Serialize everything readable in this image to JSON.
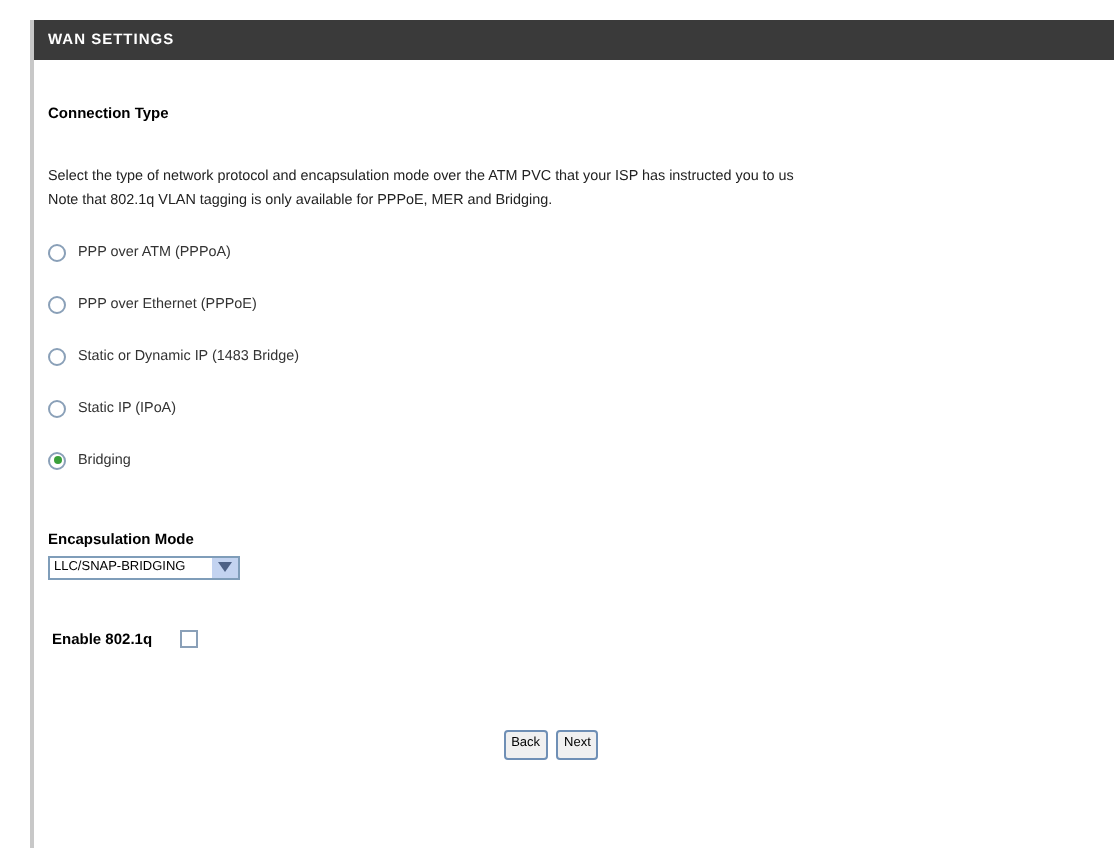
{
  "header": {
    "title": "WAN SETTINGS"
  },
  "section": {
    "title": "Connection Type",
    "description": [
      "Select the type of network protocol and encapsulation mode over the ATM PVC that your ISP has instructed you to us",
      "Note that 802.1q VLAN tagging is only available for PPPoE, MER and Bridging."
    ]
  },
  "options": [
    {
      "label": "PPP over ATM (PPPoA)",
      "selected": false
    },
    {
      "label": "PPP over Ethernet (PPPoE)",
      "selected": false
    },
    {
      "label": "Static or Dynamic IP (1483 Bridge)",
      "selected": false
    },
    {
      "label": "Static IP (IPoA)",
      "selected": false
    },
    {
      "label": "Bridging",
      "selected": true
    }
  ],
  "encapsulation": {
    "label": "Encapsulation Mode",
    "value": "LLC/SNAP-BRIDGING"
  },
  "vlan": {
    "label": "Enable 802.1q",
    "checked": false
  },
  "buttons": [
    "Back",
    "Next"
  ]
}
